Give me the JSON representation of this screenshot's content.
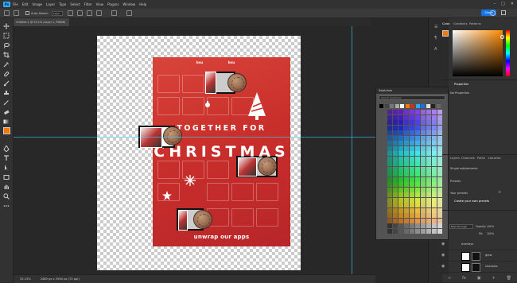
{
  "app": {
    "logo": "Ps"
  },
  "menu": [
    "File",
    "Edit",
    "Image",
    "Layer",
    "Type",
    "Select",
    "Filter",
    "View",
    "Plugins",
    "Window",
    "Help"
  ],
  "options": {
    "auto_select": "Auto-Select:",
    "layer_value": "Layer",
    "share_label": "Share"
  },
  "tab": {
    "title": "Untitled-1 @ 33.1% (Layer 1, RGB/8)"
  },
  "status": {
    "zoom": "33.13%",
    "doc_info": "2480 px x 2940 px (72 ppi)"
  },
  "poster": {
    "brand_left": "bvu",
    "brand_right": "bvu",
    "title_line1": "TOGETHER FOR",
    "title_line2": "CHRISTMAS",
    "footer": "unwrap our apps"
  },
  "swatches": {
    "title": "Swatches",
    "search_placeholder": "Search Swatches"
  },
  "color_panel": {
    "tabs": [
      "Color",
      "Gradients",
      "Patterns"
    ]
  },
  "properties_panel": {
    "title": "Properties",
    "subtitle": "No Properties"
  },
  "adjust_panel": {
    "tabs": [
      "Layers",
      "Channels",
      "Paths",
      "Libraries"
    ],
    "item1": "Single adjustments",
    "item2": "Presets",
    "item3": "Your presets",
    "create_text": "Create your own presets"
  },
  "layers": {
    "opacity_label": "Opacity:",
    "opacity": "100%",
    "fill_label": "Fill:",
    "fill": "100%",
    "blend": "Pass Through",
    "rows": [
      "overlays",
      "glow",
      "shadows"
    ]
  },
  "colors": {
    "foreground": "#f07a00",
    "accent": "#31a8ff",
    "share": "#1473e6"
  },
  "icons": [
    "move-tool-icon",
    "marquee-tool-icon",
    "lasso-tool-icon",
    "crop-tool-icon",
    "eyedropper-tool-icon",
    "brush-tool-icon",
    "eraser-tool-icon",
    "gradient-tool-icon",
    "pen-tool-icon",
    "type-tool-icon",
    "hand-tool-icon",
    "zoom-tool-icon"
  ]
}
